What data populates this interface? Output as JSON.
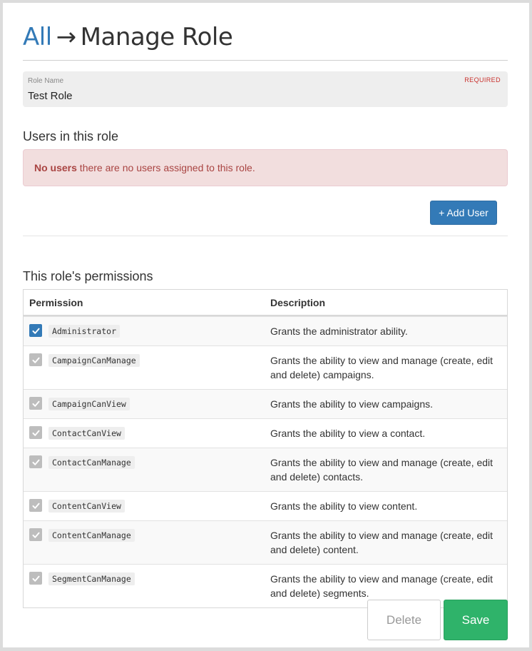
{
  "header": {
    "breadcrumb_all": "All",
    "arrow": "→",
    "title": "Manage Role"
  },
  "role_name_field": {
    "label": "Role Name",
    "required_label": "REQUIRED",
    "value": "Test Role"
  },
  "users_section": {
    "heading": "Users in this role",
    "alert_strong": "No users",
    "alert_text": " there are no users assigned to this role.",
    "add_user_label": "+ Add User"
  },
  "permissions_section": {
    "heading": "This role's permissions",
    "columns": [
      "Permission",
      "Description"
    ],
    "rows": [
      {
        "name": "Administrator",
        "description": "Grants the administrator ability.",
        "checked": true
      },
      {
        "name": "CampaignCanManage",
        "description": "Grants the ability to view and manage (create, edit and delete) campaigns.",
        "checked": false
      },
      {
        "name": "CampaignCanView",
        "description": "Grants the ability to view campaigns.",
        "checked": false
      },
      {
        "name": "ContactCanView",
        "description": "Grants the ability to view a contact.",
        "checked": false
      },
      {
        "name": "ContactCanManage",
        "description": "Grants the ability to view and manage (create, edit and delete) contacts.",
        "checked": false
      },
      {
        "name": "ContentCanView",
        "description": "Grants the ability to view content.",
        "checked": false
      },
      {
        "name": "ContentCanManage",
        "description": "Grants the ability to view and manage (create, edit and delete) content.",
        "checked": false
      },
      {
        "name": "SegmentCanManage",
        "description": "Grants the ability to view and manage (create, edit and delete) segments.",
        "checked": false
      }
    ]
  },
  "actions": {
    "delete_label": "Delete",
    "save_label": "Save"
  },
  "colors": {
    "primary": "#337ab7",
    "success": "#2fb36a",
    "danger_bg": "#f2dede",
    "danger_text": "#a94442"
  },
  "icons": {
    "checkbox": "check-icon"
  }
}
